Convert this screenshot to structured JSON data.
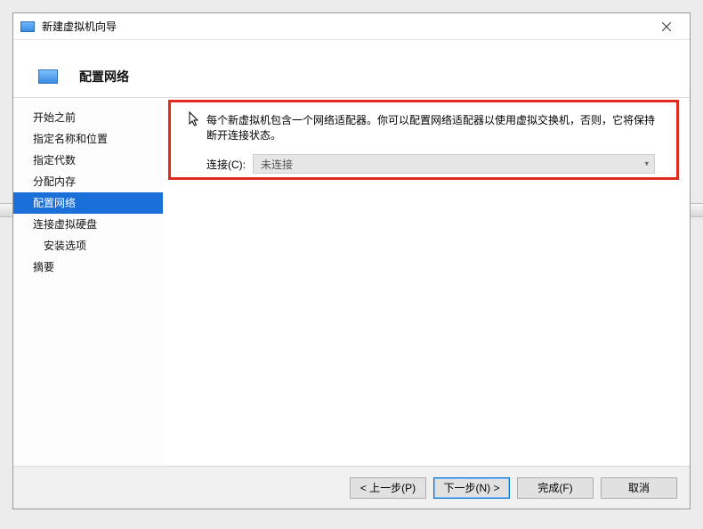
{
  "window": {
    "title": "新建虚拟机向导"
  },
  "header": {
    "title": "配置网络"
  },
  "sidebar": {
    "items": [
      {
        "label": "开始之前"
      },
      {
        "label": "指定名称和位置"
      },
      {
        "label": "指定代数"
      },
      {
        "label": "分配内存"
      },
      {
        "label": "配置网络",
        "selected": true
      },
      {
        "label": "连接虚拟硬盘"
      },
      {
        "label": "安装选项",
        "indent": true
      },
      {
        "label": "摘要"
      }
    ]
  },
  "content": {
    "description": "每个新虚拟机包含一个网络适配器。你可以配置网络适配器以使用虚拟交换机，否则，它将保持断开连接状态。",
    "connection_label": "连接(C):",
    "connection_value": "未连接"
  },
  "footer": {
    "prev": "< 上一步(P)",
    "next": "下一步(N) >",
    "finish": "完成(F)",
    "cancel": "取消"
  }
}
